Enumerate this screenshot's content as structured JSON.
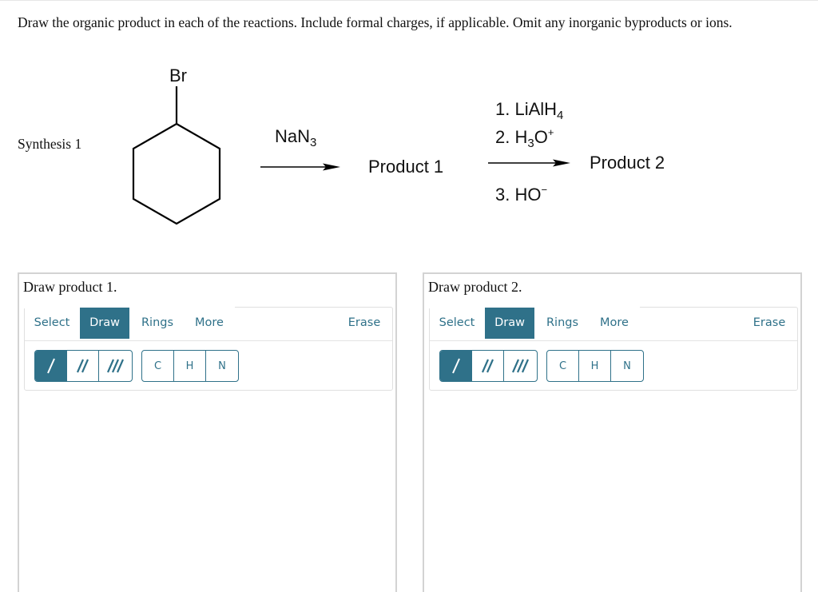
{
  "instructions": "Draw the organic product in each of the reactions. Include formal charges, if applicable. Omit any inorganic byproducts or ions.",
  "synthesis": {
    "label": "Synthesis 1",
    "starting_material": {
      "name": "bromocyclohexane",
      "substituent_label": "Br"
    },
    "step1": {
      "reagent_main": "NaN",
      "reagent_sub": "3",
      "product_label": "Product 1"
    },
    "step2": {
      "reagent_lines": [
        {
          "prefix": "1. LiAlH",
          "sub": "4",
          "sup": ""
        },
        {
          "prefix": "2. H",
          "sub": "3",
          "mid": "O",
          "sup": "+"
        },
        {
          "prefix": "3. HO",
          "sub": "",
          "sup": "−"
        }
      ],
      "product_label": "Product 2"
    }
  },
  "panels": [
    {
      "title": "Draw product 1.",
      "tabs": [
        {
          "label": "Select",
          "active": false
        },
        {
          "label": "Draw",
          "active": true
        },
        {
          "label": "Rings",
          "active": false
        },
        {
          "label": "More",
          "active": false
        }
      ],
      "erase_label": "Erase",
      "bond_tools": [
        {
          "name": "single-bond",
          "active": true
        },
        {
          "name": "double-bond",
          "active": false
        },
        {
          "name": "triple-bond",
          "active": false
        }
      ],
      "atom_tools": [
        "C",
        "H",
        "N"
      ]
    },
    {
      "title": "Draw product 2.",
      "tabs": [
        {
          "label": "Select",
          "active": false
        },
        {
          "label": "Draw",
          "active": true
        },
        {
          "label": "Rings",
          "active": false
        },
        {
          "label": "More",
          "active": false
        }
      ],
      "erase_label": "Erase",
      "bond_tools": [
        {
          "name": "single-bond",
          "active": true
        },
        {
          "name": "double-bond",
          "active": false
        },
        {
          "name": "triple-bond",
          "active": false
        }
      ],
      "atom_tools": [
        "C",
        "H",
        "N"
      ]
    }
  ],
  "colors": {
    "accent": "#2f7189",
    "panel_border": "#d3d3d3"
  }
}
